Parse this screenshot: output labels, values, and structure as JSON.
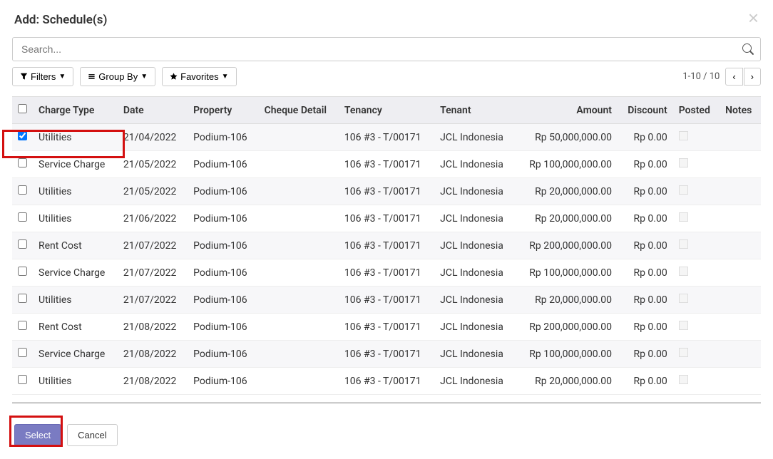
{
  "modal": {
    "title": "Add: Schedule(s)"
  },
  "search": {
    "placeholder": "Search...",
    "value": ""
  },
  "filters": {
    "filters_label": "Filters",
    "group_by_label": "Group By",
    "favorites_label": "Favorites"
  },
  "pager": {
    "info": "1-10 / 10"
  },
  "columns": {
    "charge_type": "Charge Type",
    "date": "Date",
    "property": "Property",
    "cheque_detail": "Cheque Detail",
    "tenancy": "Tenancy",
    "tenant": "Tenant",
    "amount": "Amount",
    "discount": "Discount",
    "posted": "Posted",
    "notes": "Notes"
  },
  "rows": [
    {
      "checked": true,
      "charge_type": "Utilities",
      "date": "21/04/2022",
      "property": "Podium-106",
      "cheque_detail": "",
      "tenancy": "106 #3 - T/00171",
      "tenant": "JCL Indonesia",
      "amount": "Rp 50,000,000.00",
      "discount": "Rp 0.00",
      "posted": false,
      "notes": ""
    },
    {
      "checked": false,
      "charge_type": "Service Charge",
      "date": "21/05/2022",
      "property": "Podium-106",
      "cheque_detail": "",
      "tenancy": "106 #3 - T/00171",
      "tenant": "JCL Indonesia",
      "amount": "Rp 100,000,000.00",
      "discount": "Rp 0.00",
      "posted": false,
      "notes": ""
    },
    {
      "checked": false,
      "charge_type": "Utilities",
      "date": "21/05/2022",
      "property": "Podium-106",
      "cheque_detail": "",
      "tenancy": "106 #3 - T/00171",
      "tenant": "JCL Indonesia",
      "amount": "Rp 20,000,000.00",
      "discount": "Rp 0.00",
      "posted": false,
      "notes": ""
    },
    {
      "checked": false,
      "charge_type": "Utilities",
      "date": "21/06/2022",
      "property": "Podium-106",
      "cheque_detail": "",
      "tenancy": "106 #3 - T/00171",
      "tenant": "JCL Indonesia",
      "amount": "Rp 20,000,000.00",
      "discount": "Rp 0.00",
      "posted": false,
      "notes": ""
    },
    {
      "checked": false,
      "charge_type": "Rent Cost",
      "date": "21/07/2022",
      "property": "Podium-106",
      "cheque_detail": "",
      "tenancy": "106 #3 - T/00171",
      "tenant": "JCL Indonesia",
      "amount": "Rp 200,000,000.00",
      "discount": "Rp 0.00",
      "posted": false,
      "notes": ""
    },
    {
      "checked": false,
      "charge_type": "Service Charge",
      "date": "21/07/2022",
      "property": "Podium-106",
      "cheque_detail": "",
      "tenancy": "106 #3 - T/00171",
      "tenant": "JCL Indonesia",
      "amount": "Rp 100,000,000.00",
      "discount": "Rp 0.00",
      "posted": false,
      "notes": ""
    },
    {
      "checked": false,
      "charge_type": "Utilities",
      "date": "21/07/2022",
      "property": "Podium-106",
      "cheque_detail": "",
      "tenancy": "106 #3 - T/00171",
      "tenant": "JCL Indonesia",
      "amount": "Rp 20,000,000.00",
      "discount": "Rp 0.00",
      "posted": false,
      "notes": ""
    },
    {
      "checked": false,
      "charge_type": "Rent Cost",
      "date": "21/08/2022",
      "property": "Podium-106",
      "cheque_detail": "",
      "tenancy": "106 #3 - T/00171",
      "tenant": "JCL Indonesia",
      "amount": "Rp 200,000,000.00",
      "discount": "Rp 0.00",
      "posted": false,
      "notes": ""
    },
    {
      "checked": false,
      "charge_type": "Service Charge",
      "date": "21/08/2022",
      "property": "Podium-106",
      "cheque_detail": "",
      "tenancy": "106 #3 - T/00171",
      "tenant": "JCL Indonesia",
      "amount": "Rp 100,000,000.00",
      "discount": "Rp 0.00",
      "posted": false,
      "notes": ""
    },
    {
      "checked": false,
      "charge_type": "Utilities",
      "date": "21/08/2022",
      "property": "Podium-106",
      "cheque_detail": "",
      "tenancy": "106 #3 - T/00171",
      "tenant": "JCL Indonesia",
      "amount": "Rp 20,000,000.00",
      "discount": "Rp 0.00",
      "posted": false,
      "notes": ""
    }
  ],
  "footer": {
    "select_label": "Select",
    "cancel_label": "Cancel"
  }
}
